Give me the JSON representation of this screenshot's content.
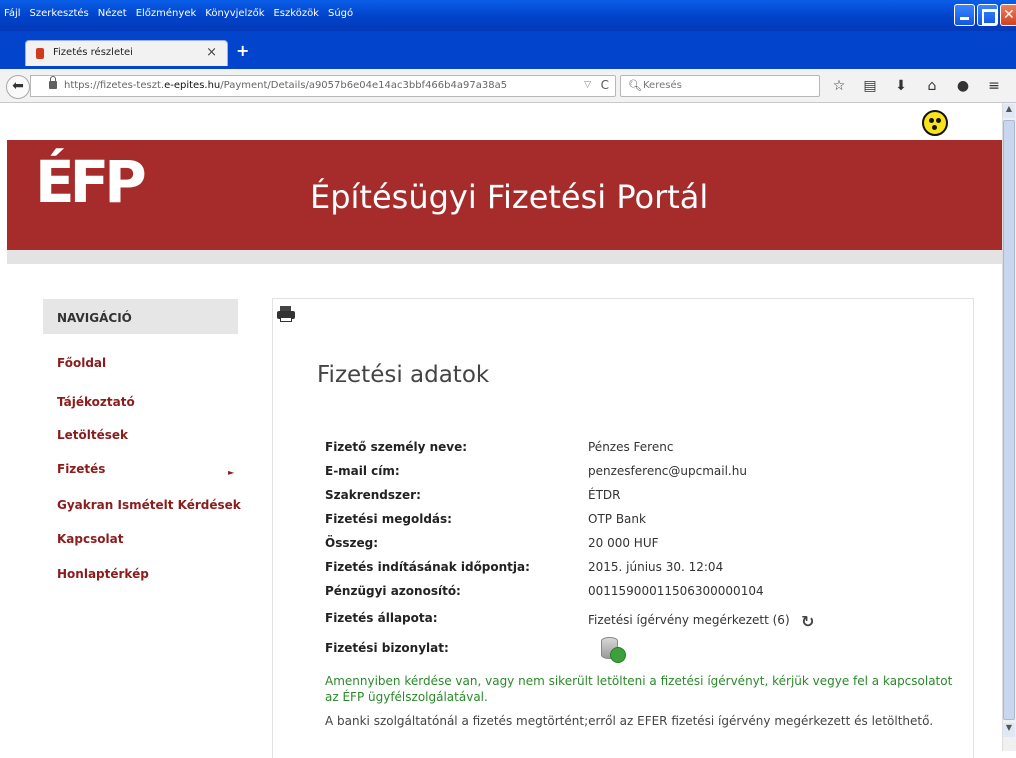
{
  "browser": {
    "menu": [
      "Fájl",
      "Szerkesztés",
      "Nézet",
      "Előzmények",
      "Könyvjelzők",
      "Eszközök",
      "Súgó"
    ],
    "tab_title": "Fizetés részletei",
    "url_prefix": "https://fizetes-teszt.",
    "url_domain": "e-epites.hu",
    "url_path": "/Payment/Details/a9057b6e04e14ac3bbf466b4a97a38a5",
    "search_placeholder": "Keresés"
  },
  "site": {
    "logo": "ÉFP",
    "title": "Építésügyi Fizetési Portál"
  },
  "nav": {
    "heading": "NAVIGÁCIÓ",
    "items": [
      "Főoldal",
      "Tájékoztató",
      "Letöltések",
      "Fizetés",
      "Gyakran Ismételt Kérdések",
      "Kapcsolat",
      "Honlaptérkép"
    ]
  },
  "main": {
    "heading": "Fizetési adatok",
    "rows": [
      {
        "label": "Fizető személy neve:",
        "value": "Pénzes Ferenc"
      },
      {
        "label": "E-mail cím:",
        "value": "penzesferenc@upcmail.hu"
      },
      {
        "label": "Szakrendszer:",
        "value": "ÉTDR"
      },
      {
        "label": "Fizetési megoldás:",
        "value": "OTP Bank"
      },
      {
        "label": "Összeg:",
        "value": "20 000 HUF"
      },
      {
        "label": "Fizetés indításának időpontja:",
        "value": "2015. június 30. 12:04"
      },
      {
        "label": "Pénzügyi azonosító:",
        "value": "00115900011506300000104"
      },
      {
        "label": "Fizetés állapota:",
        "value": "Fizetési ígérvény megérkezett (6)"
      },
      {
        "label": "Fizetési bizonylat:",
        "value": ""
      }
    ],
    "note_green": "Amennyiben kérdése van, vagy nem sikerült letölteni a fizetési ígérvényt, kérjük vegye fel a kapcsolatot az ÉFP ügyfélszolgálatával.",
    "note_gray": "A banki szolgáltatónál a fizetés megtörtént;erről az EFER fizetési ígérvény megérkezett és letölthető."
  }
}
